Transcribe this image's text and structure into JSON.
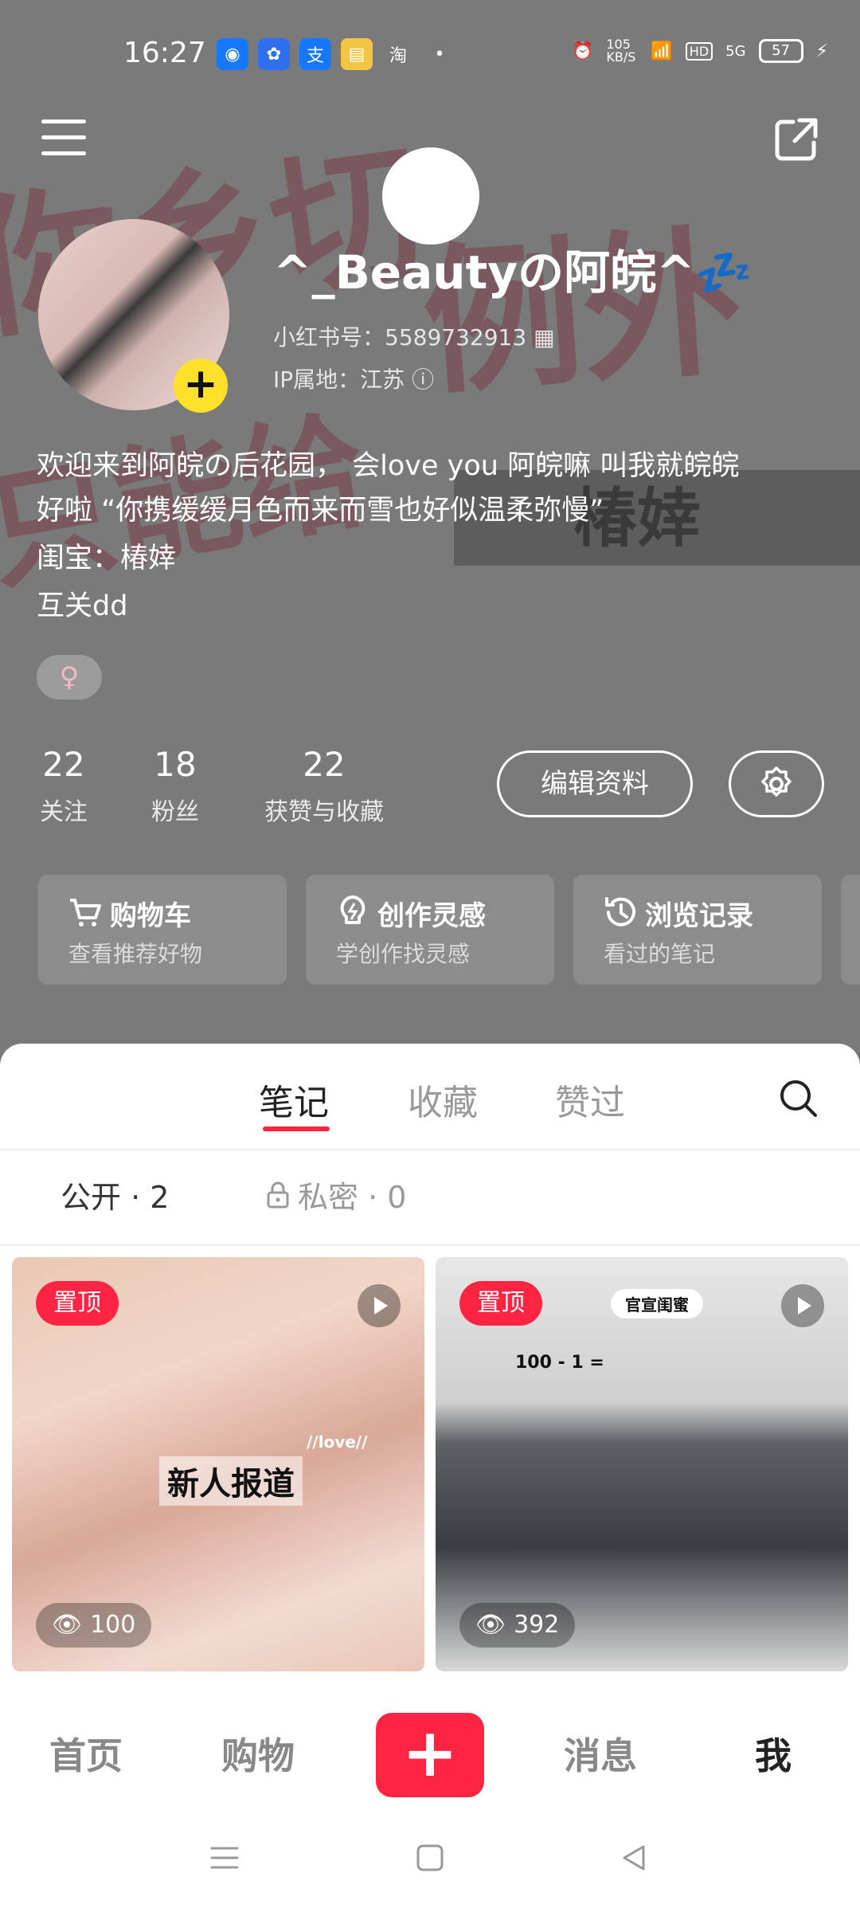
{
  "status_bar": {
    "time": "16:27",
    "network_speed": "105 KB/S",
    "network_type": "5G",
    "hd_label": "HD",
    "battery": "57",
    "app_icons": [
      "pin-icon",
      "baidu-icon",
      "alipay-icon",
      "wallet-icon",
      "taobao-icon"
    ]
  },
  "bg_text": {
    "deco1": "你乡切",
    "deco2": "例外",
    "deco3": "只能给",
    "deco4": "椿婞"
  },
  "profile": {
    "nickname": "^_Beautyの阿皖^💤",
    "red_id": "小红书号：5589732913",
    "ip": "IP属地：江苏",
    "bio_line1": "欢迎来到阿皖の后花园，  会love you 阿皖嘛  叫我就皖皖",
    "bio_line2": "好啦 “你携缓缓月色而来而雪也好似温柔弥慢”",
    "bio_line3": "闺宝：椿婞",
    "bio_line4": "互关dd",
    "gender_symbol": "♀"
  },
  "stats": {
    "following": {
      "value": "22",
      "label": "关注"
    },
    "followers": {
      "value": "18",
      "label": "粉丝"
    },
    "likes": {
      "value": "22",
      "label": "获赞与收藏"
    }
  },
  "actions": {
    "edit_label": "编辑资料"
  },
  "shortcuts": [
    {
      "title": "购物车",
      "subtitle": "查看推荐好物",
      "icon": "cart-icon"
    },
    {
      "title": "创作灵感",
      "subtitle": "学创作找灵感",
      "icon": "bulb-icon"
    },
    {
      "title": "浏览记录",
      "subtitle": "看过的笔记",
      "icon": "history-icon"
    }
  ],
  "tabs": {
    "notes": "笔记",
    "collections": "收藏",
    "liked": "赞过"
  },
  "subtabs": {
    "public": "公开 · 2",
    "private": "私密 · 0"
  },
  "cards": [
    {
      "pin": "置顶",
      "views": "100",
      "overlay_text": "新人报道",
      "overlay_small": "//love//"
    },
    {
      "pin": "置顶",
      "views": "392",
      "overlay_text": "官宣闺蜜",
      "overlay_small": "100 - 1 ="
    }
  ],
  "bottom_nav": {
    "home": "首页",
    "shop": "购物",
    "plus": "+",
    "messages": "消息",
    "me": "我"
  },
  "colors": {
    "accent": "#ff2442",
    "header_bg": "#7a7a7a",
    "add_badge": "#ffe12b"
  }
}
